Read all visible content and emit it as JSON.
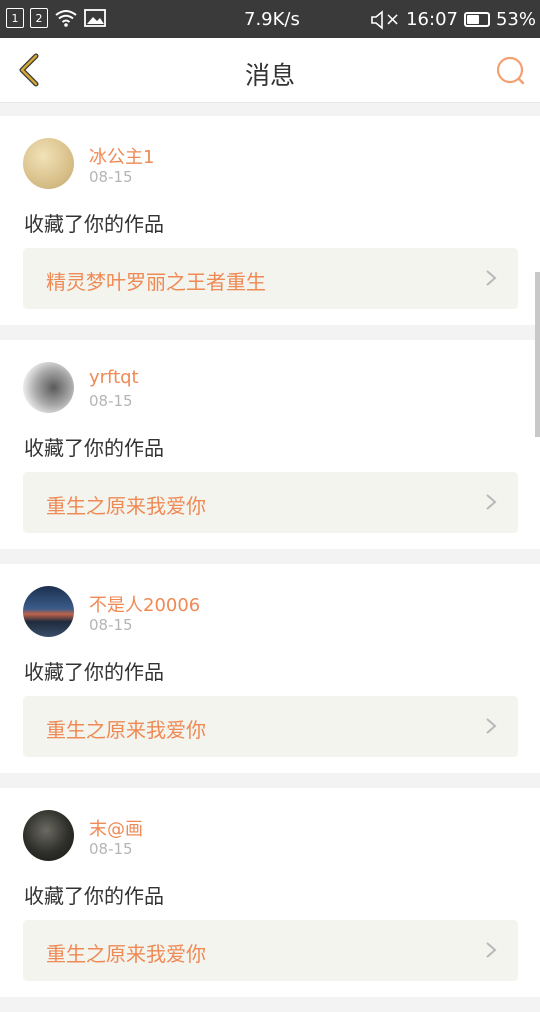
{
  "status_bar": {
    "sim1": "1",
    "sim2": "2",
    "speed": "7.9K/s",
    "mute_glyph": "×",
    "time": "16:07",
    "battery_percent": "53%",
    "battery_level": 0.53
  },
  "header": {
    "title": "消息"
  },
  "colors": {
    "accent": "#ef8a55",
    "back_icon": "#d4a933"
  },
  "messages": [
    {
      "username": "冰公主1",
      "date": "08-15",
      "action": "收藏了你的作品",
      "work_title": "精灵梦叶罗丽之王者重生"
    },
    {
      "username": "yrftqt",
      "date": "08-15",
      "action": "收藏了你的作品",
      "work_title": "重生之原来我爱你"
    },
    {
      "username": "不是人20006",
      "date": "08-15",
      "action": "收藏了你的作品",
      "work_title": "重生之原来我爱你"
    },
    {
      "username": "末@画",
      "date": "08-15",
      "action": "收藏了你的作品",
      "work_title": "重生之原来我爱你"
    }
  ]
}
